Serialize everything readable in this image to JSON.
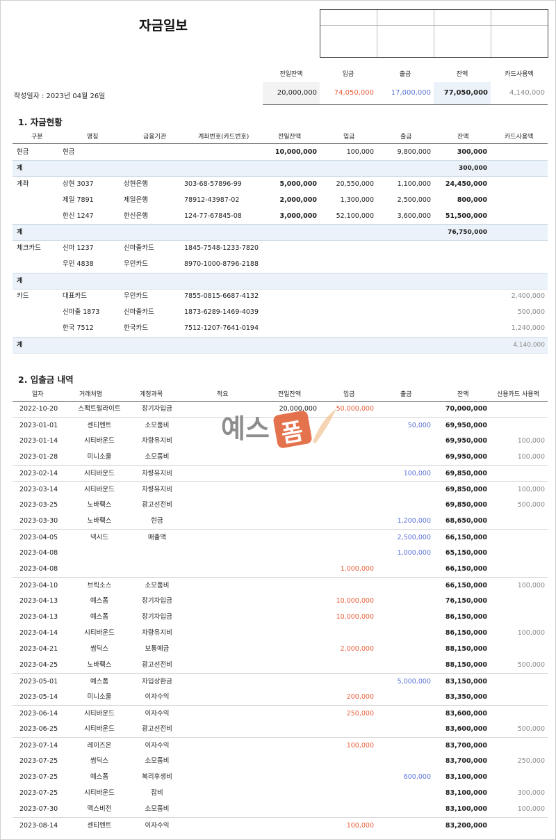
{
  "title": "자금일보",
  "date_label": "작성일자 : 2023년 04월 26일",
  "summary": {
    "headers": [
      "전일잔액",
      "입금",
      "출금",
      "잔액",
      "카드사용액"
    ],
    "values": [
      "20,000,000",
      "74,050,000",
      "17,000,000",
      "77,050,000",
      "4,140,000"
    ]
  },
  "section1": {
    "title": "1. 자금현황",
    "headers": [
      "구분",
      "명칭",
      "금융기관",
      "계좌번호(카드번호)",
      "전일잔액",
      "입금",
      "출금",
      "잔액",
      "카드사용액"
    ],
    "subtotal_label": "계",
    "cash": {
      "type": "현금",
      "name": "현금",
      "prev": "10,000,000",
      "in": "100,000",
      "out": "9,800,000",
      "bal": "300,000",
      "subtotal": "300,000"
    },
    "accounts_type": "계좌",
    "accounts": [
      {
        "name": "상현 3037",
        "bank": "상현은행",
        "no": "303-68-57896-99",
        "prev": "5,000,000",
        "in": "20,550,000",
        "out": "1,100,000",
        "bal": "24,450,000"
      },
      {
        "name": "제일 7891",
        "bank": "제일은행",
        "no": "78912-43987-02",
        "prev": "2,000,000",
        "in": "1,300,000",
        "out": "2,500,000",
        "bal": "800,000"
      },
      {
        "name": "한신 1247",
        "bank": "한신은행",
        "no": "124-77-67845-08",
        "prev": "3,000,000",
        "in": "52,100,000",
        "out": "3,600,000",
        "bal": "51,500,000"
      }
    ],
    "accounts_subtotal": "76,750,000",
    "check_type": "체크카드",
    "checks": [
      {
        "name": "신마 1237",
        "bank": "신마출카드",
        "no": "1845-7548-1233-7820"
      },
      {
        "name": "우민 4838",
        "bank": "우민카드",
        "no": "8970-1000-8796-2188"
      }
    ],
    "card_type": "카드",
    "cards": [
      {
        "name": "대표카드",
        "bank": "우민카드",
        "no": "7855-0815-6687-4132",
        "use": "2,400,000"
      },
      {
        "name": "신마출 1873",
        "bank": "신마출카드",
        "no": "1873-6289-1469-4039",
        "use": "500,000"
      },
      {
        "name": "한국 7512",
        "bank": "한국카드",
        "no": "7512-1207-7641-0194",
        "use": "1,240,000"
      }
    ],
    "cards_subtotal": "4,140,000"
  },
  "section2": {
    "title": "2. 입출금 내역",
    "headers": [
      "일자",
      "거래처명",
      "계정과목",
      "적요",
      "전일잔액",
      "입금",
      "출금",
      "잔액",
      "신용카드 사용액"
    ],
    "rows": [
      {
        "date": "2022-10-20",
        "partner": "스팩트럴라이트",
        "account": "장기차입금",
        "prev": "20,000,000",
        "in": "50,000,000",
        "out": "",
        "bal": "70,000,000",
        "card": ""
      },
      {
        "date": "2023-01-01",
        "partner": "센티멘트",
        "account": "소모품비",
        "prev": "",
        "in": "",
        "out": "50,000",
        "bal": "69,950,000",
        "card": ""
      },
      {
        "date": "2023-01-14",
        "partner": "시티바운드",
        "account": "차량유지비",
        "prev": "",
        "in": "",
        "out": "",
        "bal": "69,950,000",
        "card": "100,000"
      },
      {
        "date": "2023-01-28",
        "partner": "미니소울",
        "account": "소모품비",
        "prev": "",
        "in": "",
        "out": "",
        "bal": "69,950,000",
        "card": "100,000"
      },
      {
        "date": "2023-02-14",
        "partner": "시티바운드",
        "account": "차량유지비",
        "prev": "",
        "in": "",
        "out": "100,000",
        "bal": "69,850,000",
        "card": ""
      },
      {
        "date": "2023-03-14",
        "partner": "시티바운드",
        "account": "차량유지비",
        "prev": "",
        "in": "",
        "out": "",
        "bal": "69,850,000",
        "card": "100,000"
      },
      {
        "date": "2023-03-25",
        "partner": "노바훽스",
        "account": "광고선전비",
        "prev": "",
        "in": "",
        "out": "",
        "bal": "69,850,000",
        "card": "500,000"
      },
      {
        "date": "2023-03-30",
        "partner": "노바훽스",
        "account": "현금",
        "prev": "",
        "in": "",
        "out": "1,200,000",
        "bal": "68,650,000",
        "card": ""
      },
      {
        "date": "2023-04-05",
        "partner": "넥시드",
        "account": "매출액",
        "prev": "",
        "in": "",
        "out": "2,500,000",
        "bal": "66,150,000",
        "card": ""
      },
      {
        "date": "2023-04-08",
        "partner": "",
        "account": "",
        "prev": "",
        "in": "",
        "out": "1,000,000",
        "bal": "65,150,000",
        "card": ""
      },
      {
        "date": "2023-04-08",
        "partner": "",
        "account": "",
        "prev": "",
        "in": "1,000,000",
        "out": "",
        "bal": "66,150,000",
        "card": ""
      },
      {
        "date": "2023-04-10",
        "partner": "브릭소스",
        "account": "소모품비",
        "prev": "",
        "in": "",
        "out": "",
        "bal": "66,150,000",
        "card": "100,000"
      },
      {
        "date": "2023-04-13",
        "partner": "예스폼",
        "account": "장기차입금",
        "prev": "",
        "in": "10,000,000",
        "out": "",
        "bal": "76,150,000",
        "card": ""
      },
      {
        "date": "2023-04-13",
        "partner": "예스폼",
        "account": "장기차입금",
        "prev": "",
        "in": "10,000,000",
        "out": "",
        "bal": "86,150,000",
        "card": ""
      },
      {
        "date": "2023-04-14",
        "partner": "시티바운드",
        "account": "차량유지비",
        "prev": "",
        "in": "",
        "out": "",
        "bal": "86,150,000",
        "card": "100,000"
      },
      {
        "date": "2023-04-21",
        "partner": "썸딕스",
        "account": "보통예금",
        "prev": "",
        "in": "2,000,000",
        "out": "",
        "bal": "88,150,000",
        "card": ""
      },
      {
        "date": "2023-04-25",
        "partner": "노바훽스",
        "account": "광고선전비",
        "prev": "",
        "in": "",
        "out": "",
        "bal": "88,150,000",
        "card": "500,000"
      },
      {
        "date": "2023-05-01",
        "partner": "예스폼",
        "account": "차입상환금",
        "prev": "",
        "in": "",
        "out": "5,000,000",
        "bal": "83,150,000",
        "card": ""
      },
      {
        "date": "2023-05-14",
        "partner": "미니소울",
        "account": "이자수익",
        "prev": "",
        "in": "200,000",
        "out": "",
        "bal": "83,350,000",
        "card": ""
      },
      {
        "date": "2023-06-14",
        "partner": "시티바운드",
        "account": "이자수익",
        "prev": "",
        "in": "250,000",
        "out": "",
        "bal": "83,600,000",
        "card": ""
      },
      {
        "date": "2023-06-25",
        "partner": "시티바운드",
        "account": "광고선전비",
        "prev": "",
        "in": "",
        "out": "",
        "bal": "83,600,000",
        "card": "500,000"
      },
      {
        "date": "2023-07-14",
        "partner": "레이즈온",
        "account": "이자수익",
        "prev": "",
        "in": "100,000",
        "out": "",
        "bal": "83,700,000",
        "card": ""
      },
      {
        "date": "2023-07-25",
        "partner": "썸딕스",
        "account": "소모품비",
        "prev": "",
        "in": "",
        "out": "",
        "bal": "83,700,000",
        "card": "250,000"
      },
      {
        "date": "2023-07-25",
        "partner": "예스폼",
        "account": "복리후생비",
        "prev": "",
        "in": "",
        "out": "600,000",
        "bal": "83,100,000",
        "card": ""
      },
      {
        "date": "2023-07-25",
        "partner": "시티바운드",
        "account": "잡비",
        "prev": "",
        "in": "",
        "out": "",
        "bal": "83,100,000",
        "card": "300,000"
      },
      {
        "date": "2023-07-30",
        "partner": "맥스비전",
        "account": "소모품비",
        "prev": "",
        "in": "",
        "out": "",
        "bal": "83,100,000",
        "card": "100,000"
      },
      {
        "date": "2023-08-14",
        "partner": "센티멘트",
        "account": "이자수익",
        "prev": "",
        "in": "100,000",
        "out": "",
        "bal": "83,200,000",
        "card": ""
      }
    ]
  },
  "watermark": {
    "text": "예스폼",
    "stamp_char": "폼",
    "colors": {
      "text": "#7a7a7a",
      "stamp": "#e05a2e"
    }
  },
  "colors": {
    "in": "#e8603c",
    "out": "#5a72d6",
    "subtotal_bg": "#ebf2f9"
  }
}
